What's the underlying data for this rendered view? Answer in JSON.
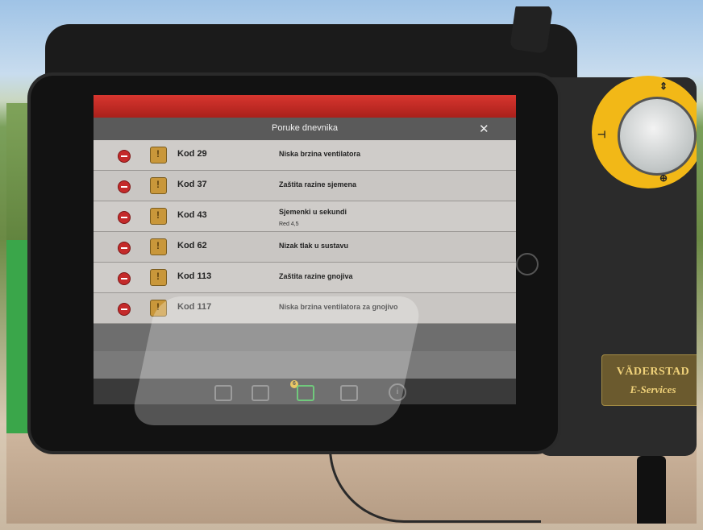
{
  "dialog": {
    "title": "Poruke dnevnika",
    "close_icon": "close-icon"
  },
  "log_messages": [
    {
      "code": "Kod 29",
      "message": "Niska brzina ventilatora",
      "detail": ""
    },
    {
      "code": "Kod 37",
      "message": "Zaštita razine sjemena",
      "detail": ""
    },
    {
      "code": "Kod 43",
      "message": "Sjemenki u sekundi",
      "detail": "Red 4,5"
    },
    {
      "code": "Kod 62",
      "message": "Nizak tlak u sustavu",
      "detail": ""
    },
    {
      "code": "Kod 113",
      "message": "Zaštita razine gnojiva",
      "detail": ""
    },
    {
      "code": "Kod 117",
      "message": "Niska brzina ventilatora za gnojivo",
      "detail": ""
    }
  ],
  "toolbar": {
    "message_badge_count": "6",
    "info_label": "i"
  },
  "hardware": {
    "brand": "VÄDERSTAD",
    "service_label": "E-Services"
  },
  "colors": {
    "header_red": "#c92a24",
    "warning_icon": "#c9973a",
    "remove_icon": "#c42a2a",
    "active_tool": "#39b54a",
    "knob_ring": "#f2b817"
  }
}
